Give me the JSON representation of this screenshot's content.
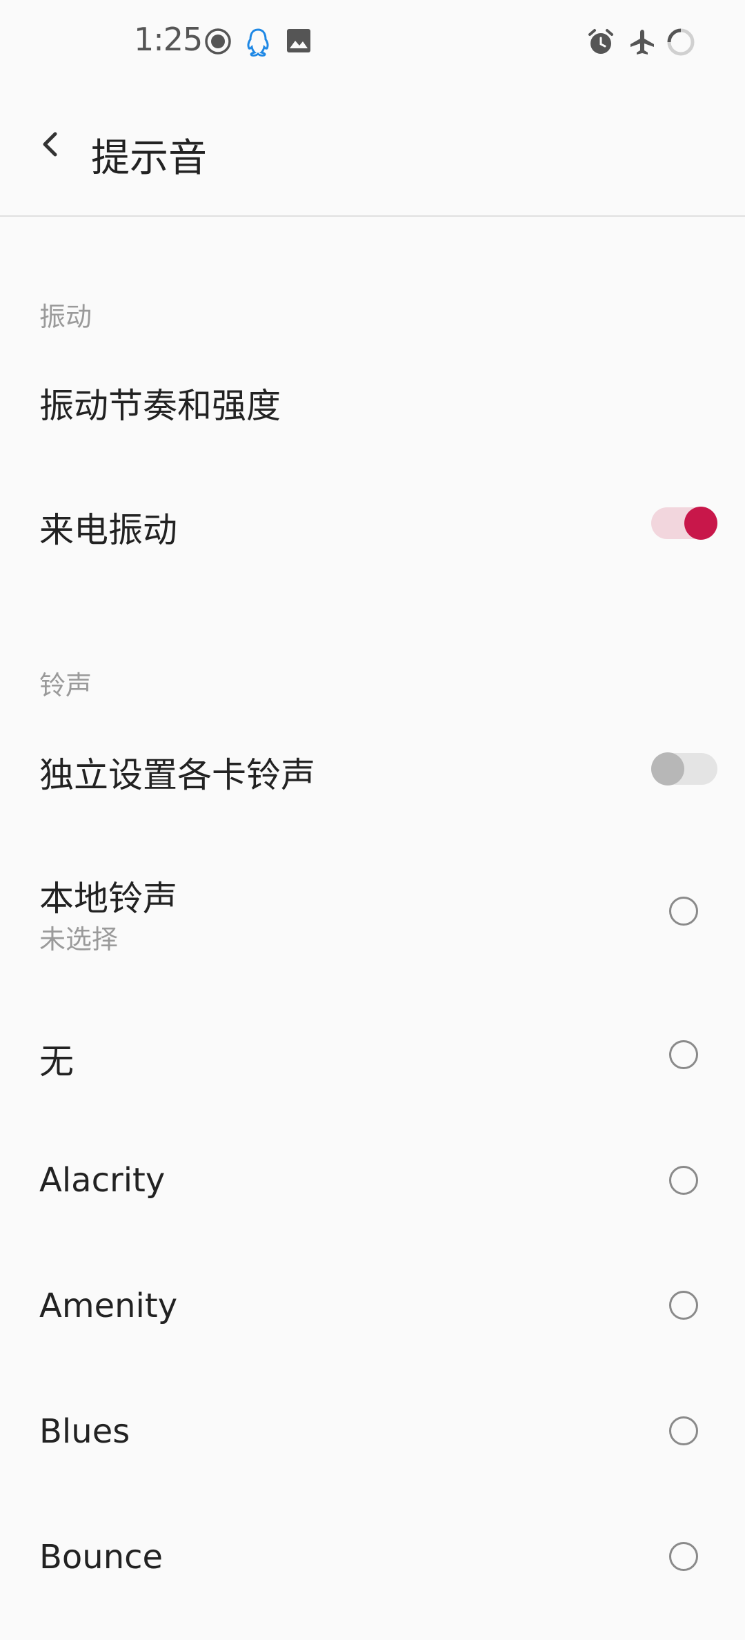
{
  "status_bar": {
    "time": "1:25",
    "left_icons": [
      "record-icon",
      "qq-icon",
      "gallery-icon"
    ],
    "right_icons": [
      "alarm-icon",
      "airplane-icon",
      "loading-icon"
    ]
  },
  "app_bar": {
    "title": "提示音",
    "back_icon": "chevron-left-icon"
  },
  "sections": {
    "vibration": {
      "header": "振动",
      "items": [
        {
          "label": "振动节奏和强度"
        },
        {
          "label": "来电振动",
          "switch_on": true
        }
      ]
    },
    "ringtone": {
      "header": "铃声",
      "items": [
        {
          "label": "独立设置各卡铃声",
          "switch_on": false
        },
        {
          "label": "本地铃声",
          "subtitle": "未选择",
          "selected": false
        },
        {
          "label": "无",
          "selected": false
        },
        {
          "label": "Alacrity",
          "selected": false
        },
        {
          "label": "Amenity",
          "selected": false
        },
        {
          "label": "Blues",
          "selected": false
        },
        {
          "label": "Bounce",
          "selected": false
        }
      ]
    }
  },
  "colors": {
    "accent": "#c8174a",
    "accent_track": "#f2d6dd",
    "background": "#fafafa",
    "qq_icon": "#1e88e5"
  }
}
